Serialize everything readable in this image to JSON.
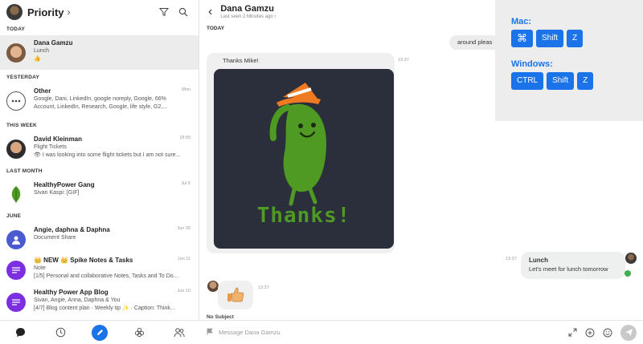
{
  "left": {
    "title": "Priority",
    "sections": {
      "today": "TODAY",
      "yesterday": "YESTERDAY",
      "this_week": "THIS WEEK",
      "last_month": "LAST MONTH",
      "june": "JUNE"
    },
    "conversations": [
      {
        "name": "Dana Gamzu",
        "line1": "Lunch",
        "line2": "👍",
        "time": ""
      },
      {
        "name": "Other",
        "line1": "Google, Dani, LinkedIn, google noreply, Google, 66%",
        "line2": "Account, LinkedIn, Research, Google, life style, G2,...",
        "time": "Mon"
      },
      {
        "name": "David Kleinman",
        "line1": "Flight Tickets",
        "line2": "👁 I was looking into some flight tickets but I am not sure...",
        "time": "18:55"
      },
      {
        "name": "HealthyPower Gang",
        "line1": "Sivan Kaspi: [GIF]",
        "line2": "",
        "time": "Jul 6"
      },
      {
        "name": "Angie, daphna & Daphna",
        "line1": "Document Share",
        "line2": "",
        "time": "Jun 26"
      },
      {
        "name": "👑 NEW 👑 Spike Notes & Tasks",
        "line1": "Note",
        "line2": "[1/5] Personal and collaborative Notes, Tasks and To Do...",
        "time": "Jun 11"
      },
      {
        "name": "Healthy Power App Blog",
        "line1": "Sivan, Angie, Anna, Daphna & You",
        "line2": "[4/7] Blog content plan · Weekly tip ✨ · Caption: Think...",
        "time": "Jun 10"
      }
    ]
  },
  "chat": {
    "title": "Dana Gamzu",
    "subtitle": "Last seen 2 Minutes ago",
    "day_label": "TODAY",
    "out_message_1": "around pleas",
    "in_message_1": "Thanks Mike!",
    "in_message_1_time": "13:37",
    "gif_caption": "Thanks!",
    "lunch_time": "13:37",
    "lunch_title": "Lunch",
    "lunch_text": "Let's meet for lunch tomorrow",
    "thumb_time": "13:37",
    "no_subject": "No Subject",
    "compose_placeholder": "Message Dana Gamzu"
  },
  "shortcuts": {
    "mac_label": "Mac:",
    "mac_keys": [
      "⌘",
      "Shift",
      "Z"
    ],
    "win_label": "Windows:",
    "win_keys": [
      "CTRL",
      "Shift",
      "Z"
    ]
  },
  "colors": {
    "accent": "#1a73e8",
    "gif_bg": "#2a2f3b",
    "bean_green": "#4f9a22",
    "hat_orange": "#f07a22"
  }
}
